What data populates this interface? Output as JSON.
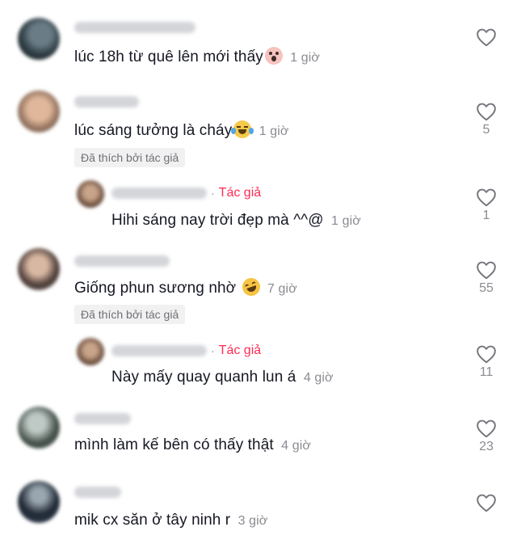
{
  "comments": [
    {
      "text": "lúc 18h từ quê lên mới thấy",
      "time": "1 giờ",
      "likes": "",
      "emoji": "shocked-emoji-icon"
    },
    {
      "text": "lúc sáng tưởng là cháy",
      "time": "1 giờ",
      "likes": "5",
      "emoji": "crying-laugh-emoji-icon",
      "liked_label": "Đã thích bởi tác giả",
      "reply": {
        "author_tag": "Tác giả",
        "text": "Hihi sáng nay trời đẹp mà ^^@",
        "time": "1 giờ",
        "likes": "1"
      }
    },
    {
      "text": "Giống phun sương nhờ",
      "time": "7 giờ",
      "likes": "55",
      "emoji": "rofl-emoji-icon",
      "liked_label": "Đã thích bởi tác giả",
      "reply": {
        "author_tag": "Tác giả",
        "text": "Này mấy quay quanh lun á",
        "time": "4 giờ",
        "likes": "11"
      }
    },
    {
      "text": "mình làm kế bên có thấy thật",
      "time": "4 giờ",
      "likes": "23"
    },
    {
      "text": "mik cx săn ở tây ninh r",
      "time": "3 giờ",
      "likes": ""
    }
  ],
  "separator": "·",
  "colors": {
    "author": "#fe2c55",
    "muted": "#8a8b91",
    "text": "#161823"
  }
}
